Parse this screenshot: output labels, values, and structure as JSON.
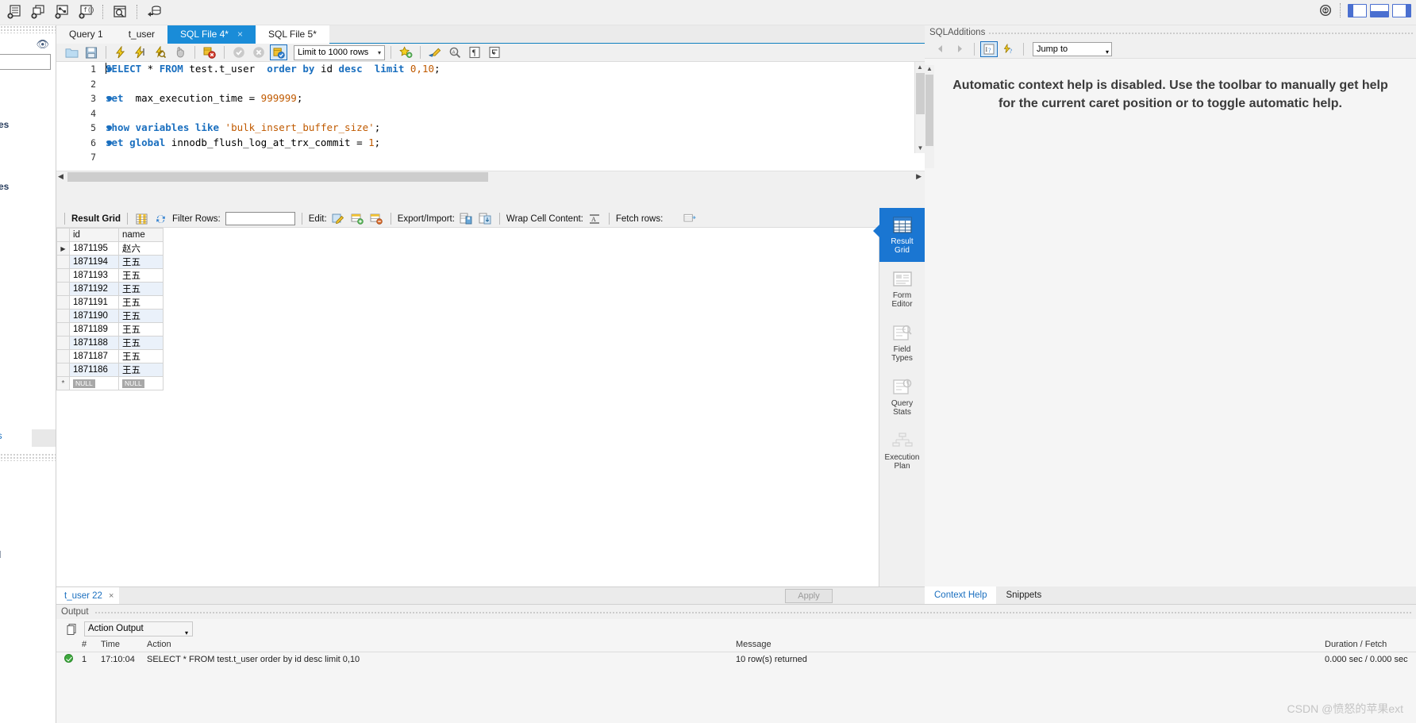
{
  "app": {
    "name": "MySQL Workbench",
    "watermark": "CSDN @愤怒的苹果ext"
  },
  "top_toolbar": {
    "buttons": [
      {
        "name": "new-schema-icon",
        "title": "Create a new schema"
      },
      {
        "name": "new-table-icon",
        "title": "Create a new table"
      },
      {
        "name": "new-view-icon",
        "title": "Create a new view"
      },
      {
        "name": "new-procedure-icon",
        "title": "Create a new stored procedure"
      },
      {
        "name": "new-function-icon",
        "title": "Create a new function"
      },
      {
        "name": "search-table-icon",
        "title": "Search table data"
      },
      {
        "name": "reconnect-server-icon",
        "title": "Reconnect to DBMS"
      }
    ],
    "settings_icon": "gear-icon",
    "pane_toggles": [
      "toggle-left-sidebar",
      "toggle-output-area",
      "toggle-right-sidebar"
    ]
  },
  "editor_tabs": [
    {
      "label": "Query 1",
      "active": false,
      "closable": false
    },
    {
      "label": "t_user",
      "active": false,
      "closable": false
    },
    {
      "label": "SQL File 4*",
      "active": true,
      "closable": true,
      "close_glyph": "×"
    },
    {
      "label": "SQL File 5*",
      "active": false,
      "closable": false
    }
  ],
  "editor_toolbar": {
    "icons": [
      {
        "name": "open-sql-file-icon"
      },
      {
        "name": "save-sql-file-icon"
      },
      {
        "name": "execute-statement-icon"
      },
      {
        "name": "execute-current-statement-icon"
      },
      {
        "name": "explain-statement-icon"
      },
      {
        "name": "stop-execution-icon"
      },
      {
        "name": "toggle-stop-on-error-icon"
      },
      {
        "name": "commit-icon"
      },
      {
        "name": "rollback-icon"
      },
      {
        "name": "toggle-autocommit-icon"
      }
    ],
    "limit_select": {
      "value": "Limit to 1000 rows",
      "arrow": "▾"
    },
    "icons_right": [
      {
        "name": "snippet-star-icon"
      },
      {
        "name": "beautify-sql-icon"
      },
      {
        "name": "find-icon"
      },
      {
        "name": "toggle-invisible-chars-icon"
      },
      {
        "name": "toggle-word-wrap-icon"
      }
    ]
  },
  "sql_editor": {
    "lines": [
      {
        "no": "1",
        "marker": true,
        "selected": true,
        "tokens": [
          {
            "t": "SELECT",
            "c": "kw"
          },
          {
            "t": " * ",
            "c": ""
          },
          {
            "t": "FROM",
            "c": "kw"
          },
          {
            "t": " test.t_user  ",
            "c": ""
          },
          {
            "t": "order",
            "c": "kw"
          },
          {
            "t": " ",
            "c": ""
          },
          {
            "t": "by",
            "c": "kw"
          },
          {
            "t": " id ",
            "c": ""
          },
          {
            "t": "desc",
            "c": "kw"
          },
          {
            "t": "  ",
            "c": ""
          },
          {
            "t": "limit",
            "c": "kw"
          },
          {
            "t": " ",
            "c": ""
          },
          {
            "t": "0,10",
            "c": "num"
          },
          {
            "t": ";",
            "c": ""
          }
        ],
        "plain": "SELECT * FROM test.t_user  order by id desc  limit 0,10;"
      },
      {
        "no": "2",
        "marker": false,
        "selected": false,
        "tokens": [],
        "plain": ""
      },
      {
        "no": "3",
        "marker": true,
        "selected": false,
        "tokens": [
          {
            "t": "set",
            "c": "kw"
          },
          {
            "t": "  max_execution_time = ",
            "c": ""
          },
          {
            "t": "999999",
            "c": "num"
          },
          {
            "t": ";",
            "c": ""
          }
        ],
        "plain": "set  max_execution_time = 999999;"
      },
      {
        "no": "4",
        "marker": false,
        "selected": false,
        "tokens": [],
        "plain": ""
      },
      {
        "no": "5",
        "marker": true,
        "selected": false,
        "tokens": [
          {
            "t": "show",
            "c": "kw"
          },
          {
            "t": " ",
            "c": ""
          },
          {
            "t": "variables",
            "c": "kw"
          },
          {
            "t": " ",
            "c": ""
          },
          {
            "t": "like",
            "c": "kw"
          },
          {
            "t": " ",
            "c": ""
          },
          {
            "t": "'bulk_insert_buffer_size'",
            "c": "str"
          },
          {
            "t": ";",
            "c": ""
          }
        ],
        "plain": "show variables like 'bulk_insert_buffer_size';"
      },
      {
        "no": "6",
        "marker": true,
        "selected": false,
        "tokens": [
          {
            "t": "set",
            "c": "kw"
          },
          {
            "t": " ",
            "c": ""
          },
          {
            "t": "global",
            "c": "kw"
          },
          {
            "t": " innodb_flush_log_at_trx_commit = ",
            "c": ""
          },
          {
            "t": "1",
            "c": "num"
          },
          {
            "t": ";",
            "c": ""
          }
        ],
        "plain": "set global innodb_flush_log_at_trx_commit = 1;"
      },
      {
        "no": "7",
        "marker": false,
        "selected": false,
        "tokens": [],
        "plain": ""
      }
    ]
  },
  "result_toolbar": {
    "title": "Result Grid",
    "grid_view_icon": "grid-view-icon",
    "refresh_icon": "refresh-icon",
    "filter_label": "Filter Rows:",
    "filter_value": "",
    "filter_placeholder": "",
    "edit_label": "Edit:",
    "edit_icons": [
      "edit-row-icon",
      "insert-row-icon",
      "delete-row-icon"
    ],
    "export_label": "Export/Import:",
    "export_icons": [
      "export-recordset-icon",
      "import-recordset-icon"
    ],
    "wrap_label": "Wrap Cell Content:",
    "wrap_icon": "wrap-cell-icon",
    "fetch_label": "Fetch rows:",
    "fetch_icon": "fetch-rows-icon",
    "expand_icon": "maximize-grid-icon"
  },
  "result_grid": {
    "columns": [
      "id",
      "name"
    ],
    "rows": [
      {
        "id": "1871195",
        "name": "赵六",
        "current": true
      },
      {
        "id": "1871194",
        "name": "王五",
        "current": false
      },
      {
        "id": "1871193",
        "name": "王五",
        "current": false
      },
      {
        "id": "1871192",
        "name": "王五",
        "current": false
      },
      {
        "id": "1871191",
        "name": "王五",
        "current": false
      },
      {
        "id": "1871190",
        "name": "王五",
        "current": false
      },
      {
        "id": "1871189",
        "name": "王五",
        "current": false
      },
      {
        "id": "1871188",
        "name": "王五",
        "current": false
      },
      {
        "id": "1871187",
        "name": "王五",
        "current": false
      },
      {
        "id": "1871186",
        "name": "王五",
        "current": false
      }
    ],
    "new_row": {
      "id": "NULL",
      "name": "NULL"
    },
    "current_row_marker": "▶",
    "new_row_marker": "*"
  },
  "result_sidebar": {
    "tabs": [
      {
        "label_line1": "Result",
        "label_line2": "Grid",
        "icon": "result-grid-icon",
        "active": true
      },
      {
        "label_line1": "Form",
        "label_line2": "Editor",
        "icon": "form-editor-icon",
        "active": false
      },
      {
        "label_line1": "Field",
        "label_line2": "Types",
        "icon": "field-types-icon",
        "active": false
      },
      {
        "label_line1": "Query",
        "label_line2": "Stats",
        "icon": "query-stats-icon",
        "active": false
      },
      {
        "label_line1": "Execution",
        "label_line2": "Plan",
        "icon": "execution-plan-icon",
        "active": false
      }
    ]
  },
  "grid_bottom": {
    "tab_label": "t_user 22",
    "tab_close": "×",
    "apply_label": "Apply"
  },
  "sql_additions": {
    "title": "SQLAdditions",
    "toolbar": {
      "back_icon": "back-arrow-icon",
      "forward_icon": "forward-arrow-icon",
      "context_help_icon": "context-help-icon",
      "auto_help_icon": "auto-context-help-icon",
      "jump_to": {
        "value": "Jump to",
        "arrow": "▾"
      }
    },
    "message": "Automatic context help is disabled. Use the toolbar to manually get help for the current caret position or to toggle automatic help."
  },
  "bottom_right_tabs": [
    {
      "label": "Context Help",
      "active": true
    },
    {
      "label": "Snippets",
      "active": false
    }
  ],
  "output": {
    "title": "Output",
    "selector": {
      "value": "Action Output",
      "arrow": "▾",
      "icon": "output-pane-icon"
    },
    "columns": [
      "#",
      "Time",
      "Action",
      "Message",
      "Duration / Fetch"
    ],
    "rows": [
      {
        "status": "success",
        "num": "1",
        "time": "17:10:04",
        "action": "SELECT * FROM test.t_user  order by id desc  limit 0,10",
        "message": "10 row(s) returned",
        "duration": "0.000 sec / 0.000 sec"
      }
    ]
  },
  "left_panel_fragments": {
    "word1": "ures",
    "word2": "ures",
    "tab_text": "as",
    "letter": "d"
  },
  "colors": {
    "accent_blue": "#1a8cd8",
    "tab_active": "#1a76d2",
    "keyword": "#1a6fbf",
    "literal": "#c05a00",
    "selection": "#bcd6ee",
    "grid_alt_row": "#eaf1fa",
    "success_green": "#3ea73e"
  }
}
